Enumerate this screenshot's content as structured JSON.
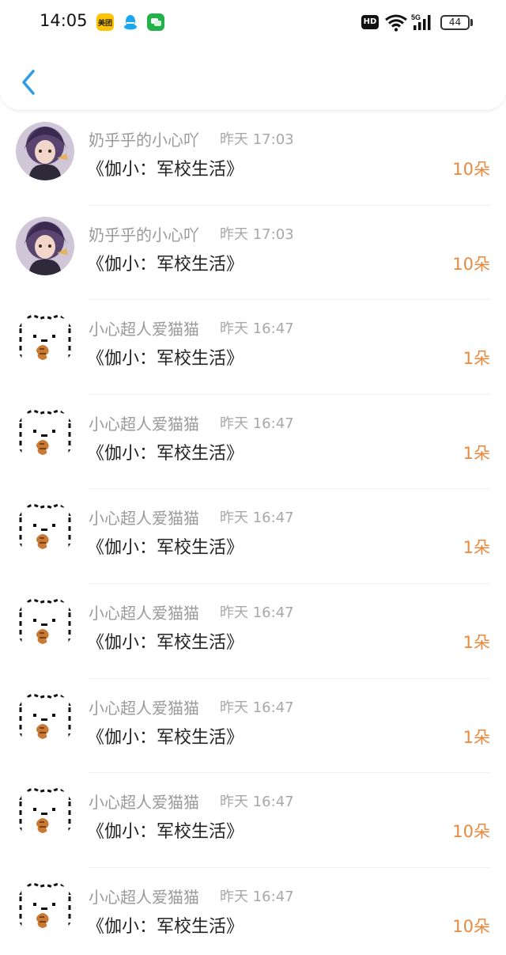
{
  "status_bar": {
    "time": "14:05",
    "meituan_label": "美团",
    "network_label": "HD",
    "signal_label": "5G",
    "battery_level": "44",
    "app_icons": [
      "meituan-icon",
      "qq-icon",
      "wechat-icon"
    ]
  },
  "header": {
    "back_icon": "chevron-left-icon",
    "accent_color": "#2f9be6"
  },
  "colors": {
    "amount": "#e9893d",
    "meta_text": "#9a9a9a",
    "title_text": "#222222"
  },
  "rows": [
    {
      "avatar": "anime-avatar",
      "username": "奶乎乎的小心吖",
      "time": "昨天 17:03",
      "title": "《伽小：军校生活》",
      "amount": "10朵"
    },
    {
      "avatar": "anime-avatar",
      "username": "奶乎乎的小心吖",
      "time": "昨天 17:03",
      "title": "《伽小：军校生活》",
      "amount": "10朵"
    },
    {
      "avatar": "bear-avatar",
      "username": "小心超人爱猫猫",
      "time": "昨天 16:47",
      "title": "《伽小：军校生活》",
      "amount": "1朵"
    },
    {
      "avatar": "bear-avatar",
      "username": "小心超人爱猫猫",
      "time": "昨天 16:47",
      "title": "《伽小：军校生活》",
      "amount": "1朵"
    },
    {
      "avatar": "bear-avatar",
      "username": "小心超人爱猫猫",
      "time": "昨天 16:47",
      "title": "《伽小：军校生活》",
      "amount": "1朵"
    },
    {
      "avatar": "bear-avatar",
      "username": "小心超人爱猫猫",
      "time": "昨天 16:47",
      "title": "《伽小：军校生活》",
      "amount": "1朵"
    },
    {
      "avatar": "bear-avatar",
      "username": "小心超人爱猫猫",
      "time": "昨天 16:47",
      "title": "《伽小：军校生活》",
      "amount": "1朵"
    },
    {
      "avatar": "bear-avatar",
      "username": "小心超人爱猫猫",
      "time": "昨天 16:47",
      "title": "《伽小：军校生活》",
      "amount": "10朵"
    },
    {
      "avatar": "bear-avatar",
      "username": "小心超人爱猫猫",
      "time": "昨天 16:47",
      "title": "《伽小：军校生活》",
      "amount": "10朵"
    }
  ]
}
